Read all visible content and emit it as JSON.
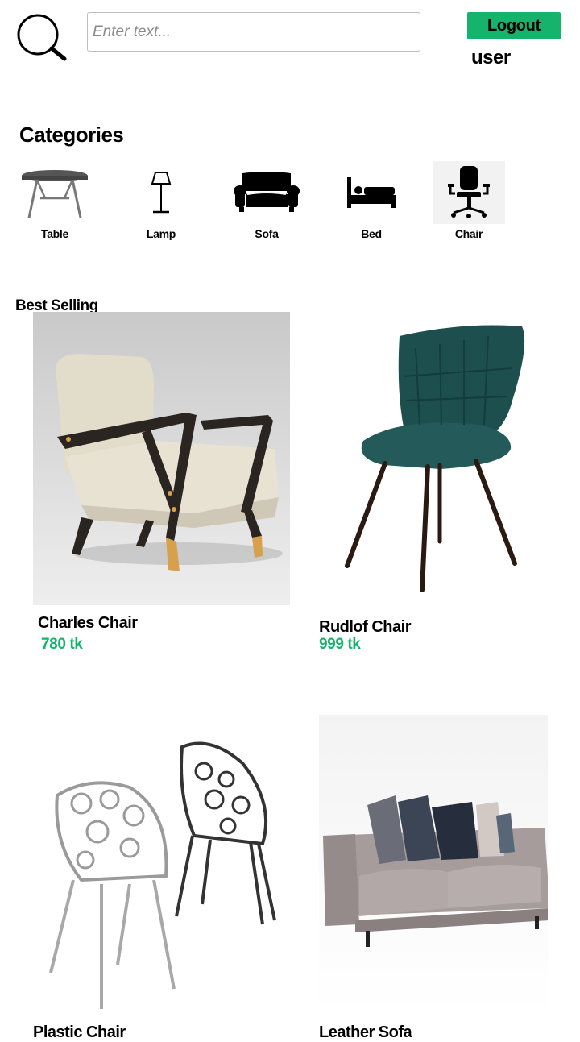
{
  "header": {
    "search_icon": "search-icon",
    "search_placeholder": "Enter text...",
    "search_value": "",
    "logout_label": "Logout",
    "username": "user"
  },
  "categories": {
    "title": "Categories",
    "items": [
      {
        "label": "Table",
        "icon": "table-icon"
      },
      {
        "label": "Lamp",
        "icon": "lamp-icon"
      },
      {
        "label": "Sofa",
        "icon": "sofa-icon"
      },
      {
        "label": "Bed",
        "icon": "bed-icon"
      },
      {
        "label": "Chair",
        "icon": "office-chair-icon",
        "selected": true
      }
    ]
  },
  "best_selling": {
    "title": "Best Selling",
    "products": [
      {
        "name": "Charles Chair",
        "price": "780 tk",
        "image": "armchair-image"
      },
      {
        "name": "Rudlof Chair",
        "price": "999 tk",
        "image": "leather-chair-image"
      },
      {
        "name": "Plastic Chair",
        "price": "",
        "image": "plastic-chairs-image"
      },
      {
        "name": "Leather Sofa",
        "price": "",
        "image": "sofa-image"
      }
    ]
  },
  "colors": {
    "accent": "#16b36c",
    "text": "#000000",
    "background": "#ffffff"
  }
}
